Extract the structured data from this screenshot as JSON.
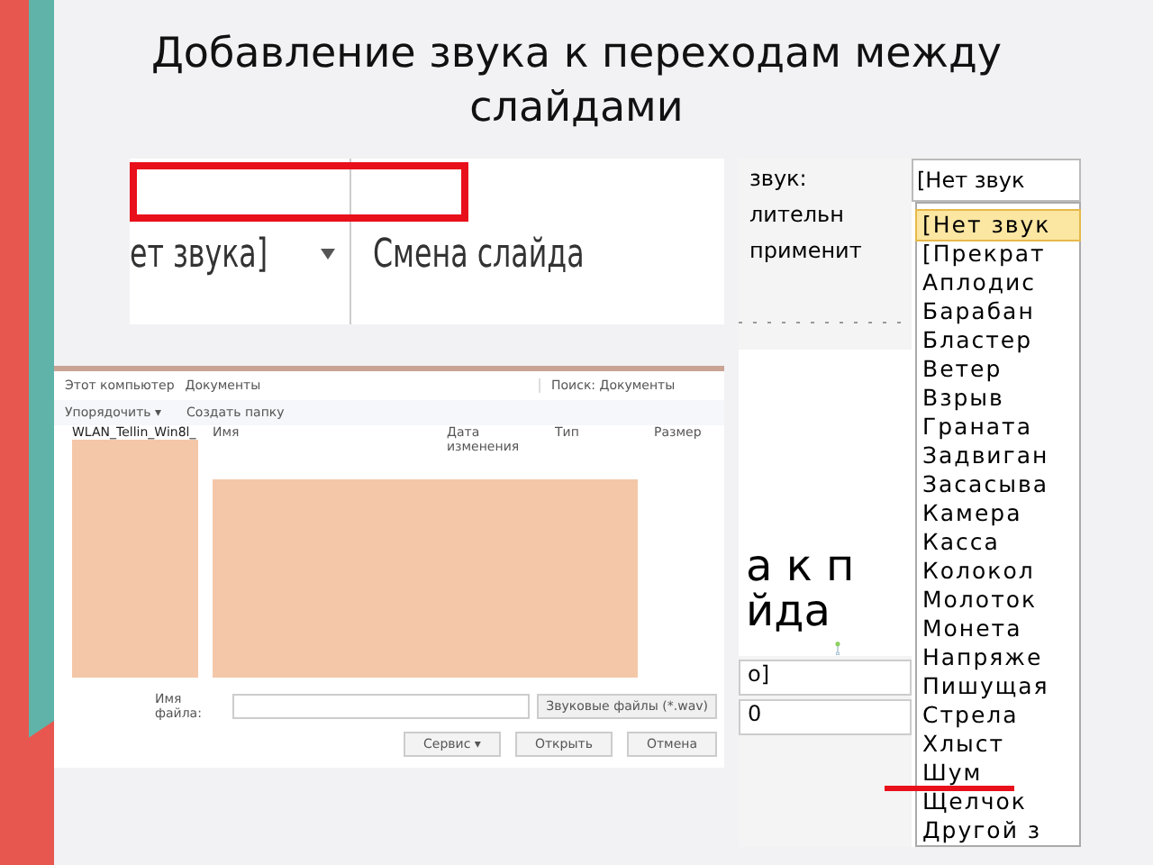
{
  "title": "Добавление звука к переходам между слайдами",
  "ribbon_crop": {
    "sound_value": "ет звука]",
    "transition_label": "Смена слайда"
  },
  "sound_panel": {
    "labels": [
      "звук:",
      "лительн",
      "применит"
    ],
    "sound_field": "[Нет звук",
    "slide_text": [
      "а к п",
      "йда"
    ],
    "field_value": "о]",
    "spinner_value": "0",
    "options": [
      {
        "label": "[Нет звук",
        "selected": true,
        "marked": false
      },
      {
        "label": "[Прекрат",
        "selected": false,
        "marked": false
      },
      {
        "label": "Аплодис",
        "selected": false,
        "marked": false
      },
      {
        "label": "Барабан",
        "selected": false,
        "marked": false
      },
      {
        "label": "Бластер",
        "selected": false,
        "marked": false
      },
      {
        "label": "Ветер",
        "selected": false,
        "marked": false
      },
      {
        "label": "Взрыв",
        "selected": false,
        "marked": false
      },
      {
        "label": "Граната",
        "selected": false,
        "marked": false
      },
      {
        "label": "Задвиган",
        "selected": false,
        "marked": false
      },
      {
        "label": "Засасыва",
        "selected": false,
        "marked": false
      },
      {
        "label": "Камера",
        "selected": false,
        "marked": false
      },
      {
        "label": "Касса",
        "selected": false,
        "marked": false
      },
      {
        "label": "Колокол",
        "selected": false,
        "marked": false
      },
      {
        "label": "Молоток",
        "selected": false,
        "marked": false
      },
      {
        "label": "Монета",
        "selected": false,
        "marked": false
      },
      {
        "label": "Напряже",
        "selected": false,
        "marked": false
      },
      {
        "label": "Пишущая",
        "selected": false,
        "marked": false
      },
      {
        "label": "Стрела",
        "selected": false,
        "marked": false
      },
      {
        "label": "Хлыст",
        "selected": false,
        "marked": false
      },
      {
        "label": "Шум",
        "selected": false,
        "marked": true
      },
      {
        "label": "Щелчок",
        "selected": false,
        "marked": false
      },
      {
        "label": "Другой з",
        "selected": false,
        "marked": false
      }
    ]
  },
  "file_dialog": {
    "breadcrumbs": [
      "Этот компьютер",
      "Документы"
    ],
    "search_placeholder": "Поиск: Документы",
    "toolbar": [
      "Упорядочить ▾",
      "Создать папку"
    ],
    "nav_first": "WLAN_Tellin_Win8l_",
    "columns": [
      "Имя",
      "Дата изменения",
      "Тип",
      "Размер"
    ],
    "filename_label": "Имя файла:",
    "filter": "Звуковые файлы (*.wav)",
    "buttons": [
      "Сервис ▾",
      "Открыть",
      "Отмена"
    ]
  }
}
